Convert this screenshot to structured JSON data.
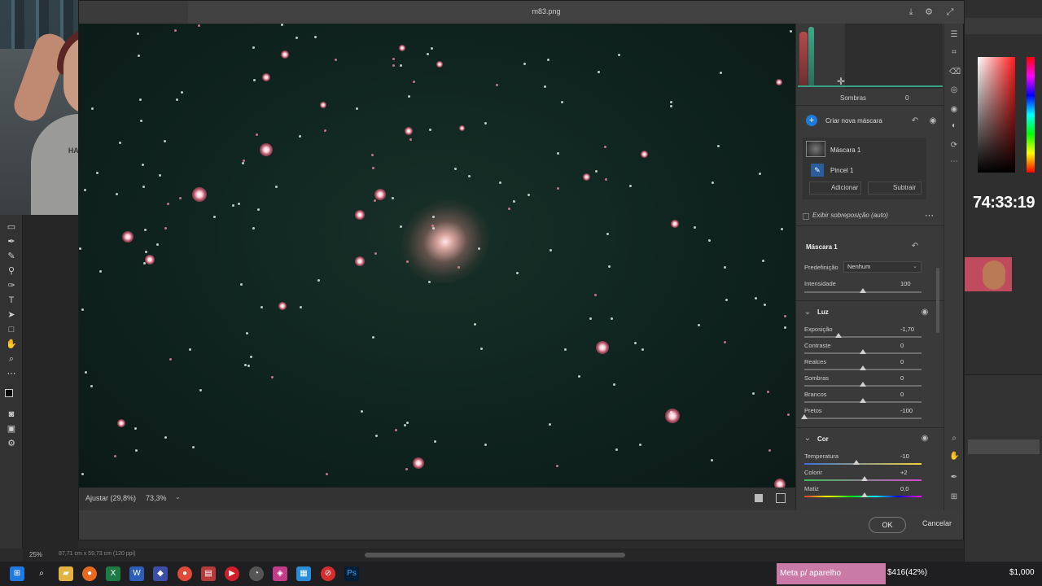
{
  "dialog": {
    "title": "m83.png",
    "bottom": {
      "fit_label": "Ajustar (29,8%)",
      "zoom_label": "73,3%"
    },
    "ok_label": "OK",
    "cancel_label": "Cancelar"
  },
  "histogram": {
    "label": "Sombras",
    "value": "0"
  },
  "masks": {
    "new_mask_label": "Criar nova máscara",
    "mask_name": "Máscara 1",
    "brush_name": "Pincel 1",
    "add_label": "Adicionar",
    "subtract_label": "Subtrair",
    "overlay_label": "Exibir sobreposição (auto)"
  },
  "mask_panel": {
    "title": "Máscara 1",
    "preset_label": "Predefinição",
    "preset_value": "Nenhum",
    "intensity_label": "Intensidade",
    "intensity_value": "100"
  },
  "light": {
    "title": "Luz",
    "rows": [
      {
        "label": "Exposição",
        "value": "-1,70"
      },
      {
        "label": "Contraste",
        "value": "0"
      },
      {
        "label": "Realces",
        "value": "0"
      },
      {
        "label": "Sombras",
        "value": "0"
      },
      {
        "label": "Brancos",
        "value": "0"
      },
      {
        "label": "Pretos",
        "value": "-100"
      }
    ]
  },
  "color": {
    "title": "Cor",
    "rows": [
      {
        "label": "Temperatura",
        "value": "-10"
      },
      {
        "label": "Colorir",
        "value": "+2"
      },
      {
        "label": "Matiz",
        "value": "0,0"
      }
    ]
  },
  "ps": {
    "zoom": "25%",
    "doc_info": "87,71 cm x 59,73 cm (120 ppi)",
    "timer": "74:33:19"
  },
  "webcam": {
    "shirt_text": "HAPPY CAMPEEN COOLED"
  },
  "taskbar": {
    "goal_label": "Meta p/ aparelho",
    "progress": "$416(42%)",
    "goal_amount": "$1,000"
  },
  "colors": {
    "accent": "#1e7ad8",
    "goal_bg": "#c97aa6",
    "star": "#e65a78"
  }
}
